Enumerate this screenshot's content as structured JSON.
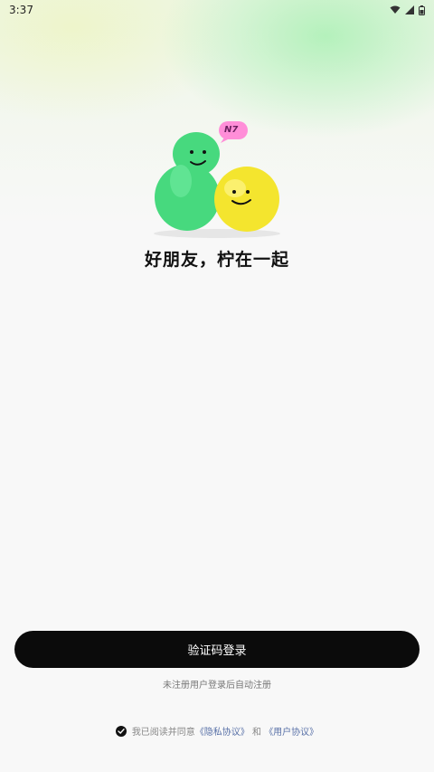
{
  "status_bar": {
    "time": "3:37",
    "icons": [
      "wifi-icon",
      "signal-icon",
      "battery-icon"
    ]
  },
  "hero": {
    "badge": "N7",
    "title": "好朋友，柠在一起"
  },
  "login": {
    "button_label": "验证码登录",
    "auto_register_note": "未注册用户登录后自动注册"
  },
  "agreement": {
    "prefix": "我已阅读并同意",
    "privacy_link": "《隐私协议》",
    "and": "和",
    "user_link": "《用户协议》",
    "checked": true
  },
  "colors": {
    "button_bg": "#0b0b0b",
    "link": "#5a72a8",
    "green_char": "#4fd98a",
    "yellow_char": "#f5e53a",
    "badge": "#ff8ed8"
  }
}
